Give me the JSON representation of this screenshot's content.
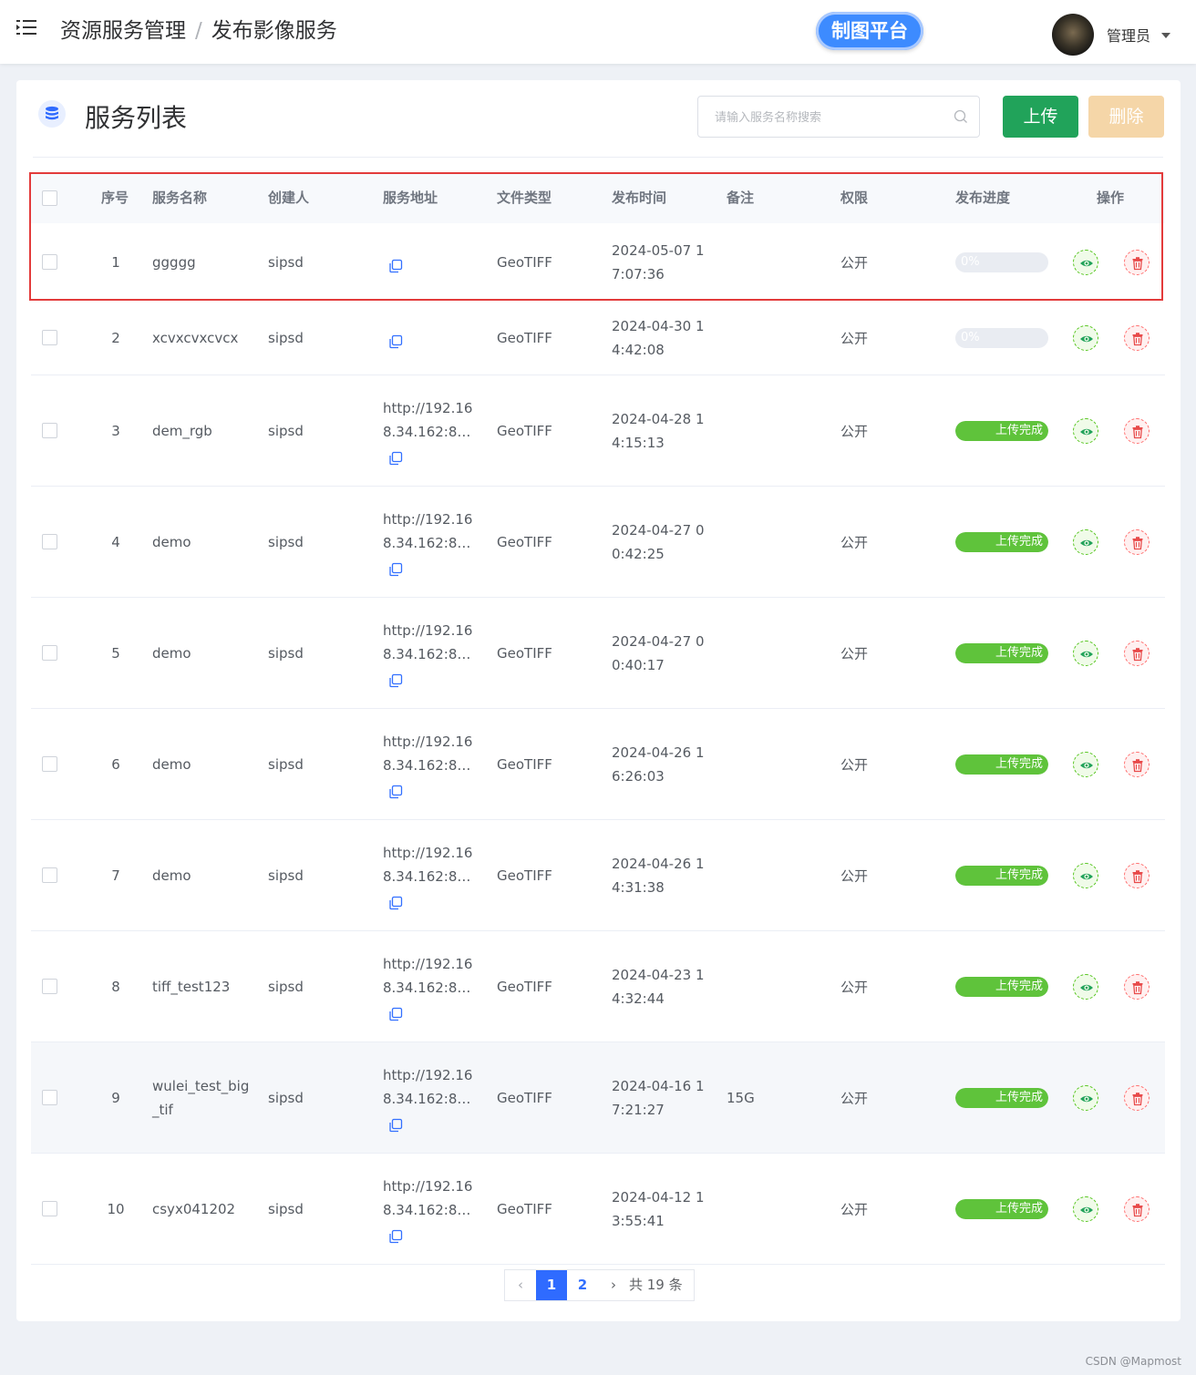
{
  "header": {
    "breadcrumb": [
      "资源服务管理",
      "发布影像服务"
    ],
    "breadcrumb_separator": "/",
    "platform_button": "制图平台",
    "user_name": "管理员"
  },
  "panel": {
    "title": "服务列表",
    "search_placeholder": "请输入服务名称搜索",
    "upload_label": "上传",
    "delete_label": "删除"
  },
  "table": {
    "columns": [
      "序号",
      "服务名称",
      "创建人",
      "服务地址",
      "文件类型",
      "发布时间",
      "备注",
      "权限",
      "发布进度",
      "操作"
    ],
    "rows": [
      {
        "index": "1",
        "name": [
          "ggggg"
        ],
        "creator": "sipsd",
        "address": null,
        "type": "GeoTIFF",
        "time": [
          "2024-05-07 1",
          "7:07:36"
        ],
        "note": "",
        "permission": "公开",
        "progress": 0,
        "progress_text": "0%"
      },
      {
        "index": "2",
        "name": [
          "xcvxcvxcvcx"
        ],
        "creator": "sipsd",
        "address": null,
        "type": "GeoTIFF",
        "time": [
          "2024-04-30 1",
          "4:42:08"
        ],
        "note": "",
        "permission": "公开",
        "progress": 0,
        "progress_text": "0%"
      },
      {
        "index": "3",
        "name": [
          "dem_rgb"
        ],
        "creator": "sipsd",
        "address": [
          "http://192.16",
          "8.34.162:81..."
        ],
        "type": "GeoTIFF",
        "time": [
          "2024-04-28 1",
          "4:15:13"
        ],
        "note": "",
        "permission": "公开",
        "progress": 100,
        "progress_text": "上传完成"
      },
      {
        "index": "4",
        "name": [
          "demo"
        ],
        "creator": "sipsd",
        "address": [
          "http://192.16",
          "8.34.162:81..."
        ],
        "type": "GeoTIFF",
        "time": [
          "2024-04-27 0",
          "0:42:25"
        ],
        "note": "",
        "permission": "公开",
        "progress": 100,
        "progress_text": "上传完成"
      },
      {
        "index": "5",
        "name": [
          "demo"
        ],
        "creator": "sipsd",
        "address": [
          "http://192.16",
          "8.34.162:81..."
        ],
        "type": "GeoTIFF",
        "time": [
          "2024-04-27 0",
          "0:40:17"
        ],
        "note": "",
        "permission": "公开",
        "progress": 100,
        "progress_text": "上传完成"
      },
      {
        "index": "6",
        "name": [
          "demo"
        ],
        "creator": "sipsd",
        "address": [
          "http://192.16",
          "8.34.162:81..."
        ],
        "type": "GeoTIFF",
        "time": [
          "2024-04-26 1",
          "6:26:03"
        ],
        "note": "",
        "permission": "公开",
        "progress": 100,
        "progress_text": "上传完成"
      },
      {
        "index": "7",
        "name": [
          "demo"
        ],
        "creator": "sipsd",
        "address": [
          "http://192.16",
          "8.34.162:81..."
        ],
        "type": "GeoTIFF",
        "time": [
          "2024-04-26 1",
          "4:31:38"
        ],
        "note": "",
        "permission": "公开",
        "progress": 100,
        "progress_text": "上传完成"
      },
      {
        "index": "8",
        "name": [
          "tiff_test123"
        ],
        "creator": "sipsd",
        "address": [
          "http://192.16",
          "8.34.162:81..."
        ],
        "type": "GeoTIFF",
        "time": [
          "2024-04-23 1",
          "4:32:44"
        ],
        "note": "",
        "permission": "公开",
        "progress": 100,
        "progress_text": "上传完成"
      },
      {
        "index": "9",
        "name": [
          "wulei_test_big",
          "_tif"
        ],
        "creator": "sipsd",
        "address": [
          "http://192.16",
          "8.34.162:81..."
        ],
        "type": "GeoTIFF",
        "time": [
          "2024-04-16 1",
          "7:21:27"
        ],
        "note": "15G",
        "permission": "公开",
        "progress": 100,
        "progress_text": "上传完成"
      },
      {
        "index": "10",
        "name": [
          "csyx041202"
        ],
        "creator": "sipsd",
        "address": [
          "http://192.16",
          "8.34.162:81..."
        ],
        "type": "GeoTIFF",
        "time": [
          "2024-04-12 1",
          "3:55:41"
        ],
        "note": "",
        "permission": "公开",
        "progress": 100,
        "progress_text": "上传完成"
      }
    ]
  },
  "pagination": {
    "pages": [
      "1",
      "2"
    ],
    "current": "1",
    "total_text": "共 19 条"
  },
  "watermark": "CSDN @Mapmost",
  "colors": {
    "primary": "#2f6bff",
    "upload": "#21a35a",
    "delete_disabled": "#f5d6a8",
    "progress_done": "#5fc33b",
    "highlight": "#e33b3b"
  }
}
